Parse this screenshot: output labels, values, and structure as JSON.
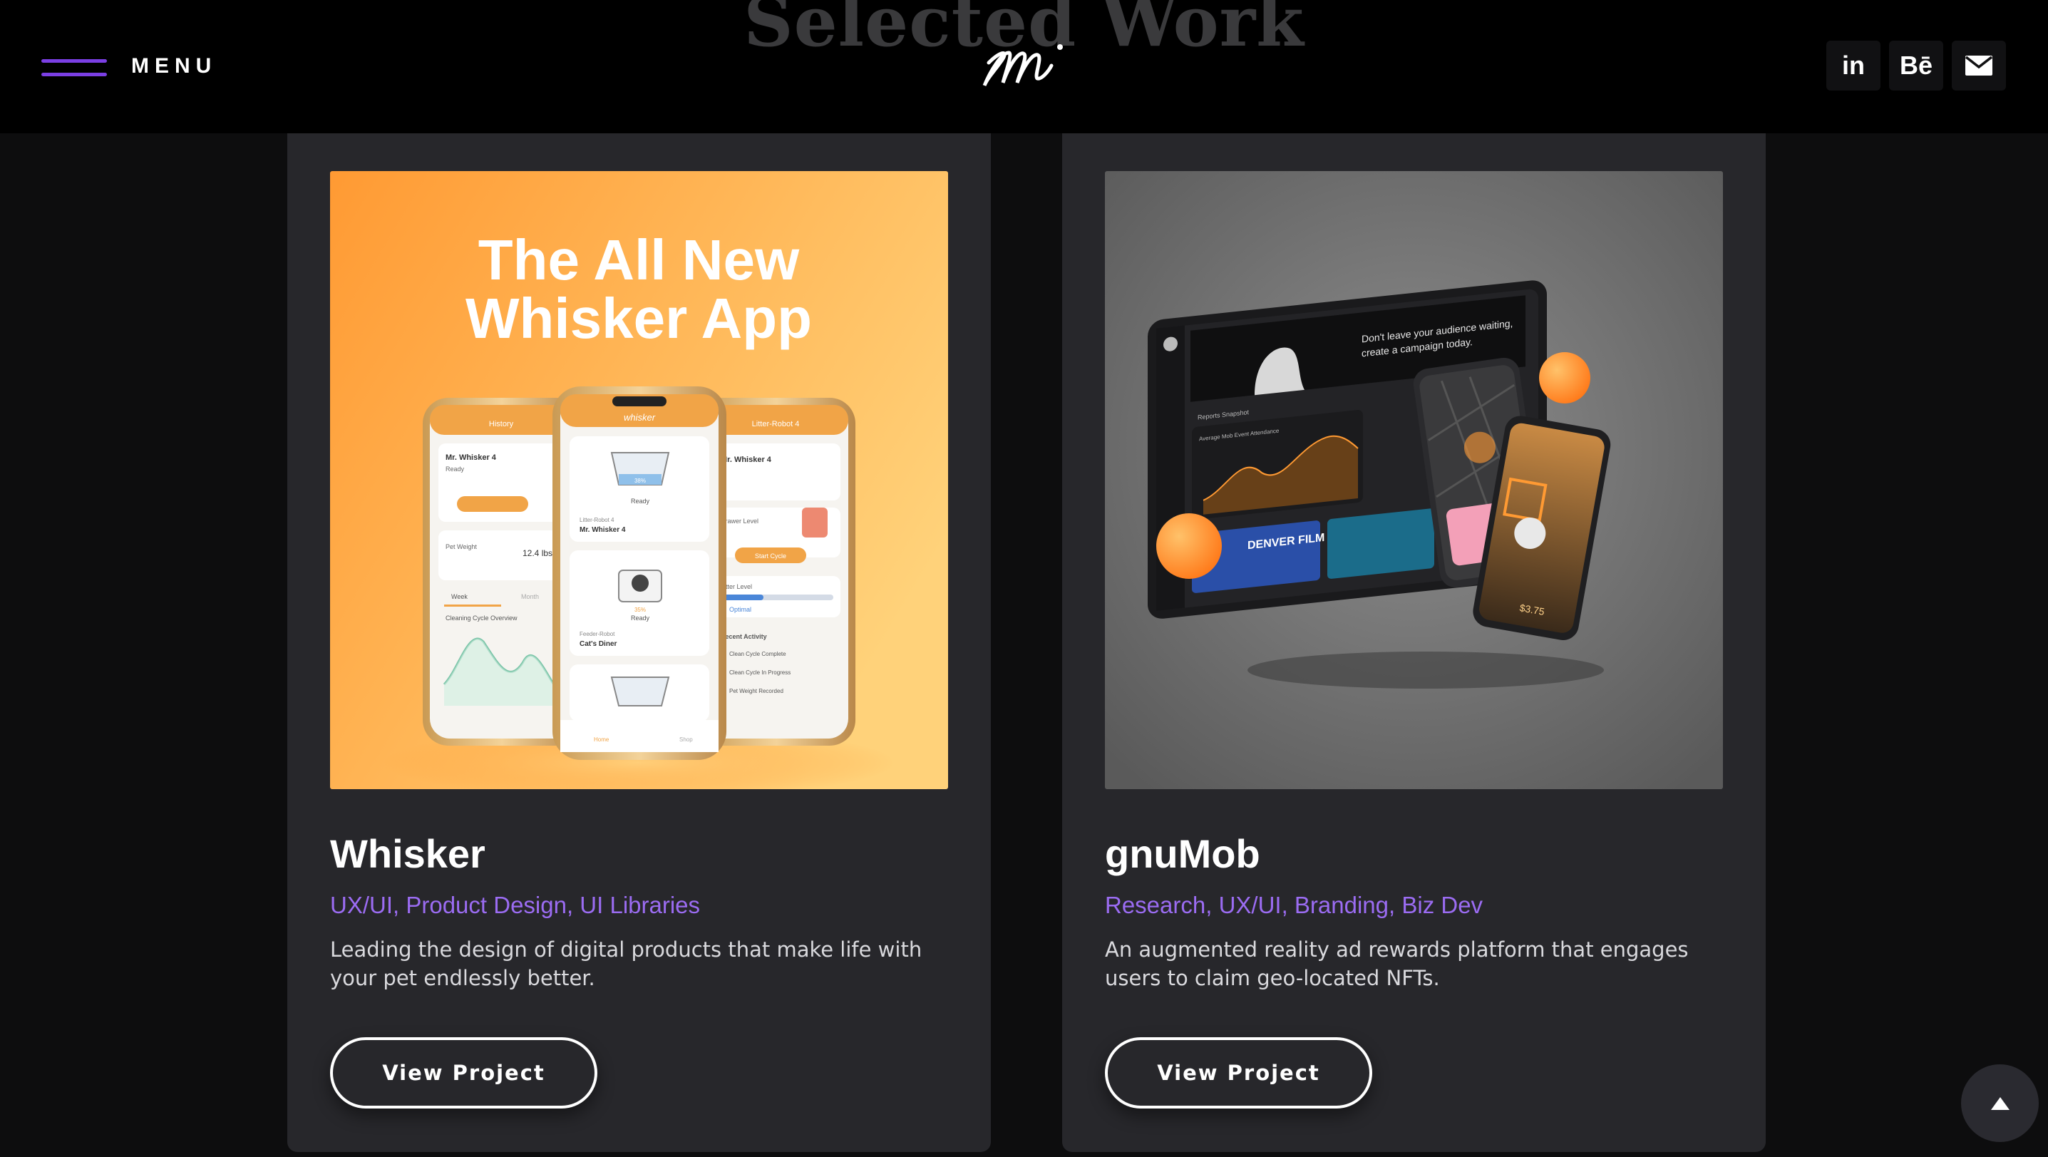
{
  "header": {
    "menu_label": "MENU",
    "section_heading": "Selected Work",
    "logo_name": "em-monogram-logo",
    "social": [
      {
        "label": "in",
        "icon": "linkedin-icon"
      },
      {
        "label": "Bē",
        "icon": "behance-icon"
      },
      {
        "label": "",
        "icon": "mail-icon"
      }
    ]
  },
  "projects": [
    {
      "title": "Whisker",
      "tags": "UX/UI, Product Design, UI Libraries",
      "description": "Leading the design of digital products that make life with your pet endlessly better.",
      "button_label": "View Project",
      "image": {
        "headline_line1": "The All New",
        "headline_line2": "Whisker App",
        "phone_left": {
          "header": "History",
          "name": "Mr. Whisker 4",
          "status": "Ready",
          "weight_label": "Pet Weight",
          "weight_value": "12.4 lbs",
          "tabs": [
            "Week",
            "Month"
          ],
          "chart_label": "Cleaning Cycle Overview"
        },
        "phone_center": {
          "brand": "whisker",
          "level": "38%",
          "status": "Ready",
          "robot_label": "Litter-Robot 4",
          "robot_name": "Mr. Whisker 4",
          "feeder_level": "35%",
          "feeder_status": "Ready",
          "feeder_label": "Feeder-Robot",
          "feeder_name": "Cat's Diner",
          "bottom_tabs": [
            "Home",
            "Shop"
          ]
        },
        "phone_right": {
          "header": "Litter-Robot 4",
          "name": "Mr. Whisker 4",
          "drawer_label": "Drawer Level",
          "button": "Start Cycle",
          "litter_label": "Litter Level",
          "litter_value": "Optimal",
          "activity_label": "Recent Activity",
          "activity": [
            "Clean Cycle Complete",
            "Clean Cycle In Progress",
            "Pet Weight Recorded"
          ]
        }
      }
    },
    {
      "title": "gnuMob",
      "tags": "Research, UX/UI, Branding, Biz Dev",
      "description": "An augmented reality ad rewards platform that engages users to claim geo-located NFTs.",
      "button_label": "View Project",
      "image": {
        "tablet_text": "Don't leave your audience waiting, create a campaign today.",
        "chart_label": "Average Mob Event Attendance",
        "section_label": "Reports Snapshot",
        "festival_label": "DENVER FILM FESTIVAL",
        "phone_price": "$3.75"
      }
    }
  ],
  "colors": {
    "accent": "#9b6cf2",
    "burger": "#7b3fe4",
    "card_bg": "#27272b",
    "page_bg": "#0d0d0e",
    "orange": "#ff9a33"
  }
}
